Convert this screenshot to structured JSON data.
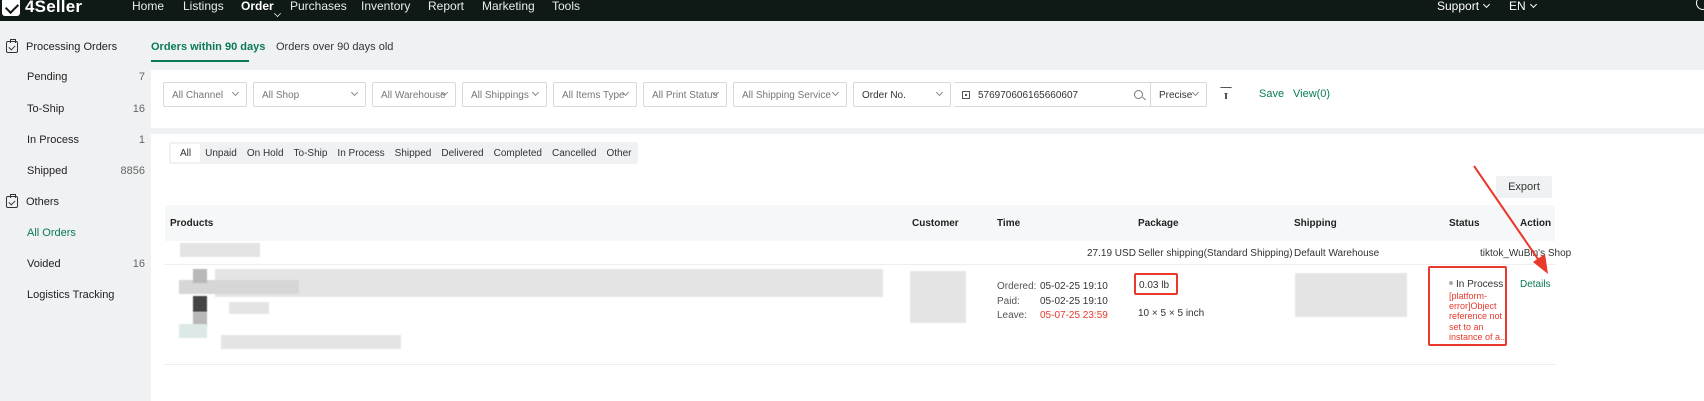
{
  "brand": {
    "name": "4Seller"
  },
  "nav": {
    "items": [
      "Home",
      "Listings",
      "Order",
      "Purchases",
      "Inventory",
      "Report",
      "Marketing",
      "Tools"
    ],
    "support": "Support",
    "language": "EN"
  },
  "sidebar": {
    "processing_group": "Processing Orders",
    "processing_items": [
      {
        "label": "Pending",
        "count": "7"
      },
      {
        "label": "To-Ship",
        "count": "16"
      },
      {
        "label": "In Process",
        "count": "1"
      },
      {
        "label": "Shipped",
        "count": "8856"
      }
    ],
    "others_group": "Others",
    "others_items": [
      {
        "label": "All Orders",
        "count": ""
      },
      {
        "label": "Voided",
        "count": "16"
      },
      {
        "label": "Logistics Tracking",
        "count": ""
      }
    ]
  },
  "top_tabs": [
    "Orders within 90 days",
    "Orders over 90 days old"
  ],
  "filters": {
    "channel": "All Channel",
    "shop": "All Shop",
    "warehouse": "All Warehouse",
    "shippings": "All Shippings",
    "items_type": "All Items Type",
    "print_status": "All Print Status",
    "shipping_service": "All Shipping Service",
    "search_by": "Order No.",
    "search_value": "576970606165660607",
    "match_mode": "Precise",
    "save": "Save",
    "view": "View(0)"
  },
  "status_tabs": [
    "All",
    "Unpaid",
    "On Hold",
    "To-Ship",
    "In Process",
    "Shipped",
    "Delivered",
    "Completed",
    "Cancelled",
    "Other"
  ],
  "export_label": "Export",
  "table": {
    "headers": [
      "Products",
      "Customer",
      "Time",
      "Package",
      "Shipping",
      "Status",
      "Action"
    ],
    "order": {
      "amount": "27.19 USD",
      "shipping_method": "Seller shipping(Standard Shipping)",
      "warehouse": "Default Warehouse",
      "shop": "tiktok_WuBin's Shop",
      "ordered_label": "Ordered:",
      "ordered": "05-02-25 19:10",
      "paid_label": "Paid:",
      "paid": "05-02-25 19:10",
      "leave_label": "Leave:",
      "leave": "05-07-25 23:59",
      "weight": "0.03 lb",
      "dimensions": "10 × 5 × 5 inch",
      "status": "In Process",
      "error_lines": [
        "[platform-",
        "error]Object",
        "reference not",
        "set to an",
        "instance of a..."
      ],
      "action": "Details"
    }
  },
  "colors": {
    "accent": "#0a7a55",
    "nav_bg": "#0f1a17",
    "highlight": "#e8392c",
    "leave_time": "#e8392c"
  }
}
